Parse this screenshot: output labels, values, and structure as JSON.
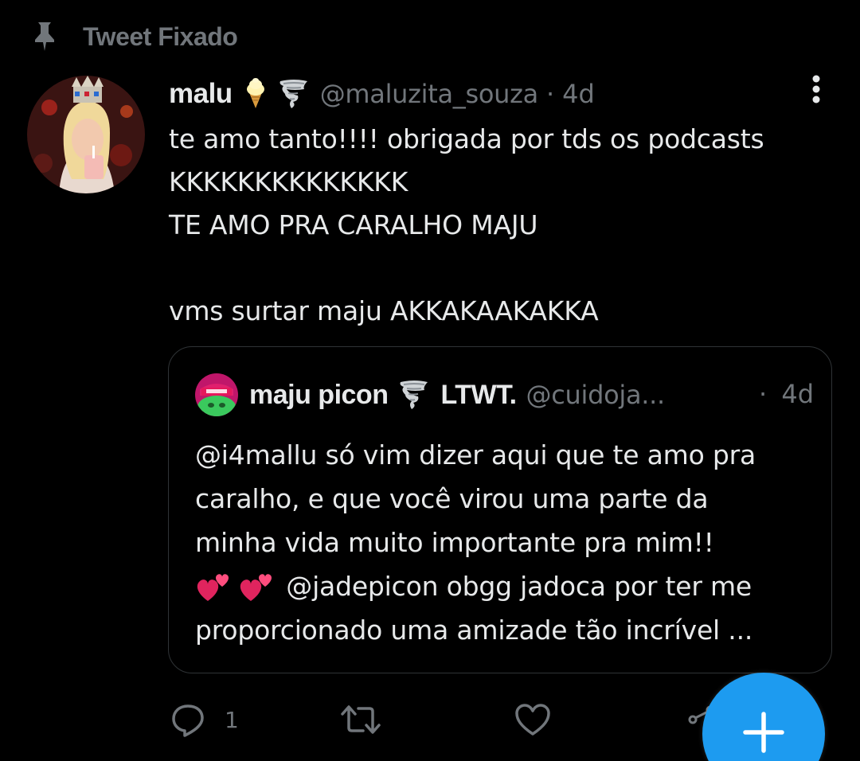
{
  "pinned": {
    "label": "Tweet Fixado",
    "icon": "pin-icon"
  },
  "tweet": {
    "author_name": "malu",
    "name_emojis": [
      "ice-cream-emoji",
      "tornado-emoji"
    ],
    "handle": "@maluzita_souza",
    "separator": "·",
    "time": "4d",
    "text_lines": [
      "te amo tanto!!!! obrigada por tds os podcasts",
      "KKKKKKKKKKKKKK",
      "TE AMO PRA CARALHO MAJU",
      "",
      "vms surtar maju AKKAKAAKAKKA"
    ]
  },
  "quote": {
    "author_name": "maju picon",
    "name_suffix": "LTWT.",
    "handle": "@cuidoja...",
    "separator": "·",
    "time": "4d",
    "text_lines": [
      "@i4mallu só vim dizer aqui que te amo pra",
      "caralho, e que você virou uma parte da",
      "minha vida muito importante pra mim!!",
      " @jadepicon obgg jadoca por ter me",
      "proporcionado uma amizade tão incrível ..."
    ],
    "inline_emojis": [
      "two-hearts-emoji",
      "two-hearts-emoji"
    ]
  },
  "actions": {
    "reply_count": "1",
    "retweet_count": "",
    "like_count": ""
  },
  "fab": {
    "icon": "plus-icon"
  },
  "colors": {
    "background": "#000000",
    "text": "#e7e9ea",
    "secondary": "#71767b",
    "border": "#2f3336",
    "accent": "#1d9bf0"
  }
}
